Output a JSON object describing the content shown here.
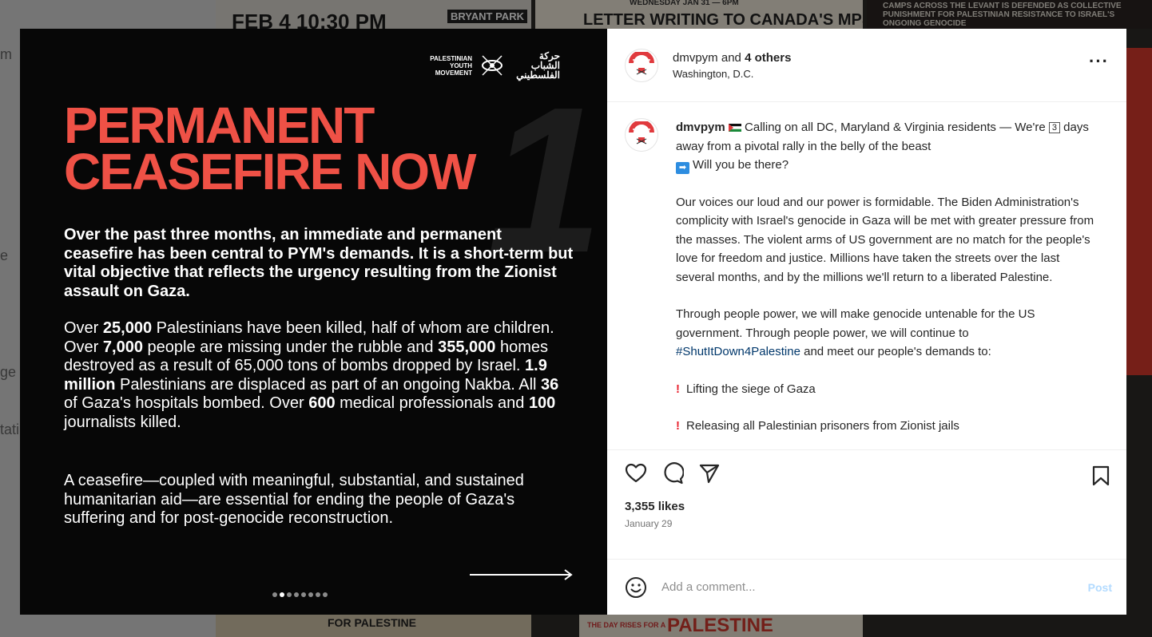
{
  "background": {
    "tiles": [
      {
        "text": "FEB 4 10:30 PM"
      },
      {
        "text": "BRYANT PARK"
      },
      {
        "text": "LETTER WRITING TO CANADA'S MPS"
      },
      {
        "text": "WEDNESDAY JAN 31 — 6PM"
      },
      {
        "text": "CAMPS ACROSS THE LEVANT IS DEFENDED AS COLLECTIVE PUNISHMENT FOR PALESTINIAN RESISTANCE TO ISRAEL'S ONGOING GENOCIDE"
      },
      {
        "text": "FOR PALESTINE"
      },
      {
        "text": "THE DAY RISES FOR A"
      },
      {
        "text": "PALESTINE"
      }
    ],
    "left_fragments": [
      "m",
      "e",
      "ge",
      "tati"
    ]
  },
  "slide": {
    "logo_text": "PALESTINIAN YOUTH MOVEMENT",
    "logo_arabic": "حركة الشباب الفلسطيني",
    "slide_number": "1",
    "headline_line1": "PERMANENT",
    "headline_line2": "CEASEFIRE NOW",
    "lead": "Over the past three months, an immediate and permanent ceasefire has been central to PYM's demands. It is a short-term but vital objective that reflects the urgency resulting from the Zionist assault on Gaza.",
    "stats": [
      {
        "t": "Over ",
        "b": false
      },
      {
        "t": "25,000",
        "b": true
      },
      {
        "t": " Palestinians have been killed, half of whom are children. Over ",
        "b": false
      },
      {
        "t": "7,000",
        "b": true
      },
      {
        "t": " people are missing under the rubble and ",
        "b": false
      },
      {
        "t": "355,000",
        "b": true
      },
      {
        "t": " homes destroyed as a result of 65,000 tons of bombs dropped by Israel. ",
        "b": false
      },
      {
        "t": "1.9 million",
        "b": true
      },
      {
        "t": " Palestinians are displaced as part of an ongoing Nakba. All ",
        "b": false
      },
      {
        "t": "36",
        "b": true
      },
      {
        "t": " of Gaza's hospitals bombed. Over ",
        "b": false
      },
      {
        "t": "600",
        "b": true
      },
      {
        "t": " medical professionals and ",
        "b": false
      },
      {
        "t": "100",
        "b": true
      },
      {
        "t": " journalists killed.",
        "b": false
      }
    ],
    "closing": "A ceasefire—coupled with meaningful, substantial, and sustained humanitarian aid—are essential for ending the people of Gaza's suffering and for post-genocide reconstruction.",
    "dots_total": 8,
    "dots_active": 2
  },
  "post": {
    "author": "dmvpym",
    "and_text": " and ",
    "others": "4 others",
    "location": "Washington, D.C.",
    "more_label": "···",
    "caption": {
      "username": "dmvpym",
      "line1_a": " Calling on all DC, Maryland & Virginia residents — We're ",
      "days_emoji": "3",
      "line1_b": " days away from a pivotal rally in the belly of the beast",
      "line1_c": "Will you be there?",
      "arrow_emoji": "➡",
      "para2": "Our voices our loud and our power is formidable. The Biden Administration's complicity with Israel's genocide in Gaza will be met with greater pressure from the masses. The violent arms of US government are no match for the people's love for freedom and justice. Millions have taken the streets over the last several months, and by the millions we'll return to a liberated Palestine.",
      "para3_a": "Through people power, we will make genocide untenable for the US government. Through people power, we will continue to ",
      "hashtag": "#ShutItDown4Palestine",
      "para3_b": " and meet our people's demands to:",
      "demand1": "Lifting the siege of Gaza",
      "demand2": "Releasing all Palestinian prisoners from Zionist jails",
      "exclaim": "!"
    },
    "likes": "3,355 likes",
    "date": "January 29",
    "comment_placeholder": "Add a comment...",
    "post_label": "Post"
  },
  "colors": {
    "headline_red": "#ef5146",
    "post_button_disabled": "#b3dbff",
    "hashtag": "#00376b"
  }
}
